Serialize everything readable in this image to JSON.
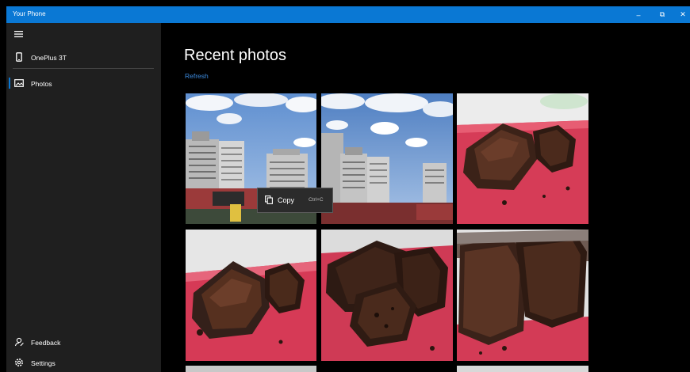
{
  "window": {
    "title": "Your Phone",
    "minimize": "–",
    "maximize": "⧉",
    "close": "✕"
  },
  "sidebar": {
    "device": {
      "label": "OnePlus 3T",
      "icon": "phone-icon"
    },
    "items": [
      {
        "label": "Photos",
        "icon": "photos-icon",
        "active": true
      }
    ],
    "footer": [
      {
        "label": "Feedback",
        "icon": "feedback-icon"
      },
      {
        "label": "Settings",
        "icon": "gear-icon"
      }
    ],
    "accent": "#0a78d4"
  },
  "main": {
    "title": "Recent photos",
    "refresh_label": "Refresh"
  },
  "photos": [
    {
      "subject": "buildings-sky"
    },
    {
      "subject": "buildings-sky"
    },
    {
      "subject": "brownie"
    },
    {
      "subject": "brownie"
    },
    {
      "subject": "brownie"
    },
    {
      "subject": "brownie"
    }
  ],
  "context_menu": {
    "label": "Copy",
    "shortcut": "Ctrl+C",
    "icon": "copy-icon"
  }
}
